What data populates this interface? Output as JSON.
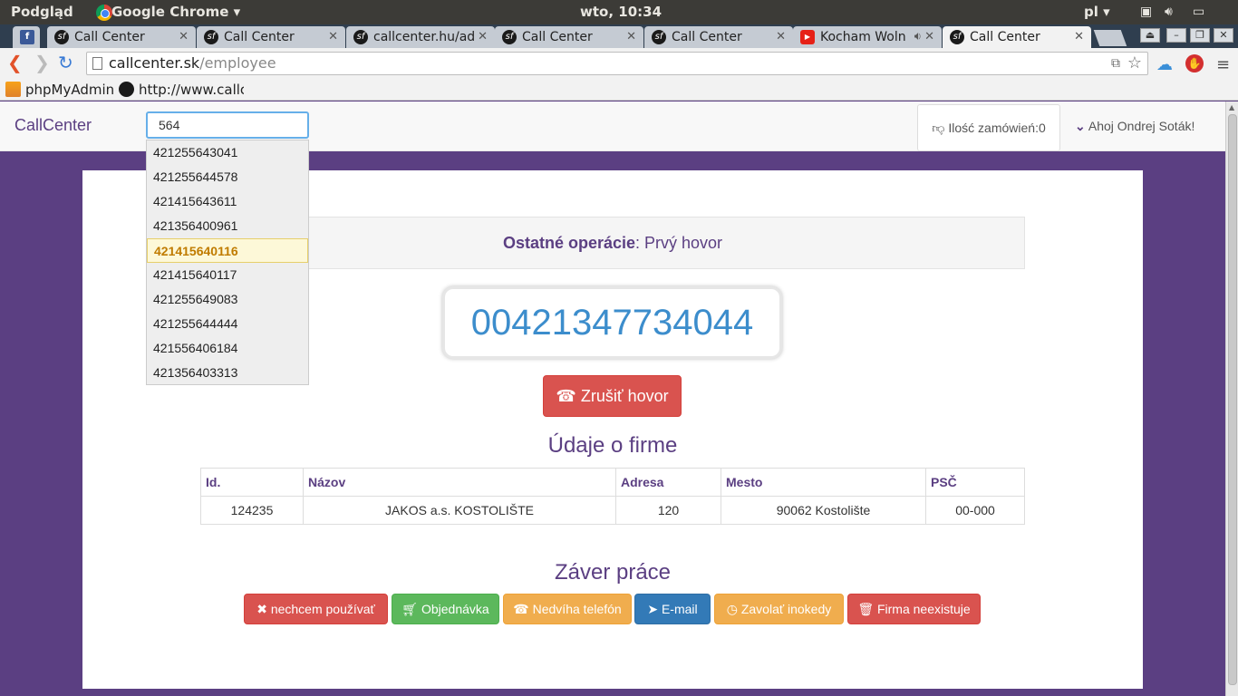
{
  "os": {
    "app_left": "Podgląd",
    "app_name": "Google Chrome",
    "clock": "wto, 10:34",
    "lang": "pl"
  },
  "tabs": [
    {
      "label": "",
      "icon": "facebook-icon"
    },
    {
      "label": "Call Center",
      "icon": "symfony-icon"
    },
    {
      "label": "Call Center",
      "icon": "symfony-icon"
    },
    {
      "label": "callcenter.hu/ad",
      "icon": "symfony-icon"
    },
    {
      "label": "Call Center",
      "icon": "symfony-icon"
    },
    {
      "label": "Call Center",
      "icon": "symfony-icon"
    },
    {
      "label": "Kocham Woln",
      "icon": "youtube-icon"
    },
    {
      "label": "Call Center",
      "icon": "symfony-icon"
    }
  ],
  "address": {
    "host": "callcenter.sk",
    "path": "/employee"
  },
  "bookmarks": [
    {
      "label": "phpMyAdmin"
    },
    {
      "label": "http://www.callc"
    }
  ],
  "navbar": {
    "brand": "CallCenter",
    "search_value": "564",
    "orders": "Ilość zamówień:0",
    "greeting": "Ahoj Ondrej Soták!"
  },
  "autocomplete": {
    "items": [
      "421255643041",
      "421255644578",
      "421415643611",
      "421356400961",
      "421415640116",
      "421415640117",
      "421255649083",
      "421255644444",
      "421556406184",
      "421356403313"
    ],
    "selected_index": 4
  },
  "main": {
    "ops_label": "Ostatné operácie",
    "ops_value": ": Prvý hovor",
    "phone_number": "00421347734044",
    "cancel_call": "Zrušiť hovor",
    "firm_heading": "Údaje o firme",
    "firm_table": {
      "headers": [
        "Id.",
        "Názov",
        "Adresa",
        "Mesto",
        "PSČ"
      ],
      "rows": [
        [
          "124235",
          "JAKOS a.s. KOSTOLIŠTE",
          "120",
          "90062 Kostolište",
          "00-000"
        ]
      ]
    },
    "end_heading": "Záver práce",
    "actions": [
      {
        "label": "nechcem používať",
        "icon": "times-icon",
        "color": "#d9534f"
      },
      {
        "label": "Objednávka",
        "icon": "cart-icon",
        "color": "#5cb85c"
      },
      {
        "label": "Nedvíha telefón",
        "icon": "phone-icon",
        "color": "#f0ad4e"
      },
      {
        "label": "E-mail",
        "icon": "send-icon",
        "color": "#337ab7"
      },
      {
        "label": "Zavolať inokedy",
        "icon": "clock-icon",
        "color": "#f0ad4e"
      },
      {
        "label": "Firma neexistuje",
        "icon": "trash-icon",
        "color": "#d9534f"
      }
    ]
  },
  "colors": {
    "brand_purple": "#5b3f82",
    "phone_blue": "#3c8dcc"
  }
}
